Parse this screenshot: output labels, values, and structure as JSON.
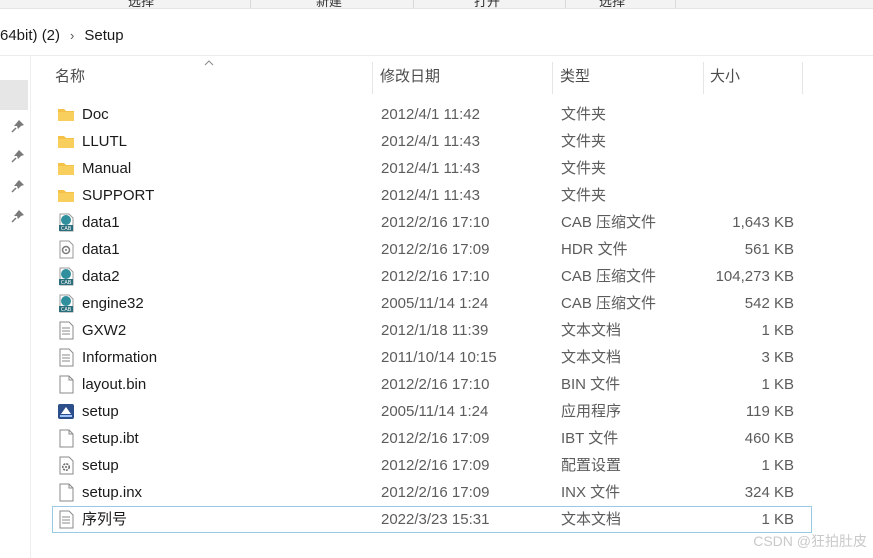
{
  "toolbar": {
    "partial_labels": [
      "选择",
      "新建",
      "打开",
      "选择"
    ]
  },
  "breadcrumb": {
    "parent": "64bit) (2)",
    "current": "Setup"
  },
  "columns": {
    "name": "名称",
    "date": "修改日期",
    "type": "类型",
    "size": "大小"
  },
  "files": [
    {
      "icon": "folder-icon",
      "name": "Doc",
      "date": "2012/4/1 11:42",
      "type": "文件夹",
      "size": ""
    },
    {
      "icon": "folder-icon",
      "name": "LLUTL",
      "date": "2012/4/1 11:43",
      "type": "文件夹",
      "size": ""
    },
    {
      "icon": "folder-icon",
      "name": "Manual",
      "date": "2012/4/1 11:43",
      "type": "文件夹",
      "size": ""
    },
    {
      "icon": "folder-icon",
      "name": "SUPPORT",
      "date": "2012/4/1 11:43",
      "type": "文件夹",
      "size": ""
    },
    {
      "icon": "cab-file-icon",
      "name": "data1",
      "date": "2012/2/16 17:10",
      "type": "CAB 压缩文件",
      "size": "1,643 KB"
    },
    {
      "icon": "hdr-file-icon",
      "name": "data1",
      "date": "2012/2/16 17:09",
      "type": "HDR 文件",
      "size": "561 KB"
    },
    {
      "icon": "cab-file-icon",
      "name": "data2",
      "date": "2012/2/16 17:10",
      "type": "CAB 压缩文件",
      "size": "104,273 KB"
    },
    {
      "icon": "cab-file-icon",
      "name": "engine32",
      "date": "2005/11/14 1:24",
      "type": "CAB 压缩文件",
      "size": "542 KB"
    },
    {
      "icon": "text-file-icon",
      "name": "GXW2",
      "date": "2012/1/18 11:39",
      "type": "文本文档",
      "size": "1 KB"
    },
    {
      "icon": "text-file-icon",
      "name": "Information",
      "date": "2011/10/14 10:15",
      "type": "文本文档",
      "size": "3 KB"
    },
    {
      "icon": "blank-file-icon",
      "name": "layout.bin",
      "date": "2012/2/16 17:10",
      "type": "BIN 文件",
      "size": "1 KB"
    },
    {
      "icon": "setup-app-icon",
      "name": "setup",
      "date": "2005/11/14 1:24",
      "type": "应用程序",
      "size": "119 KB"
    },
    {
      "icon": "blank-file-icon",
      "name": "setup.ibt",
      "date": "2012/2/16 17:09",
      "type": "IBT 文件",
      "size": "460 KB"
    },
    {
      "icon": "config-file-icon",
      "name": "setup",
      "date": "2012/2/16 17:09",
      "type": "配置设置",
      "size": "1 KB"
    },
    {
      "icon": "blank-file-icon",
      "name": "setup.inx",
      "date": "2012/2/16 17:09",
      "type": "INX 文件",
      "size": "324 KB"
    },
    {
      "icon": "text-file-icon",
      "name": "序列号",
      "date": "2022/3/23 15:31",
      "type": "文本文档",
      "size": "1 KB"
    }
  ],
  "focused_index": 15,
  "watermark": "CSDN @狂拍肚皮",
  "colors": {
    "folder": "#f5c146",
    "focus_outline": "#9ac9e6",
    "cab_teal": "#2f8f9d"
  }
}
